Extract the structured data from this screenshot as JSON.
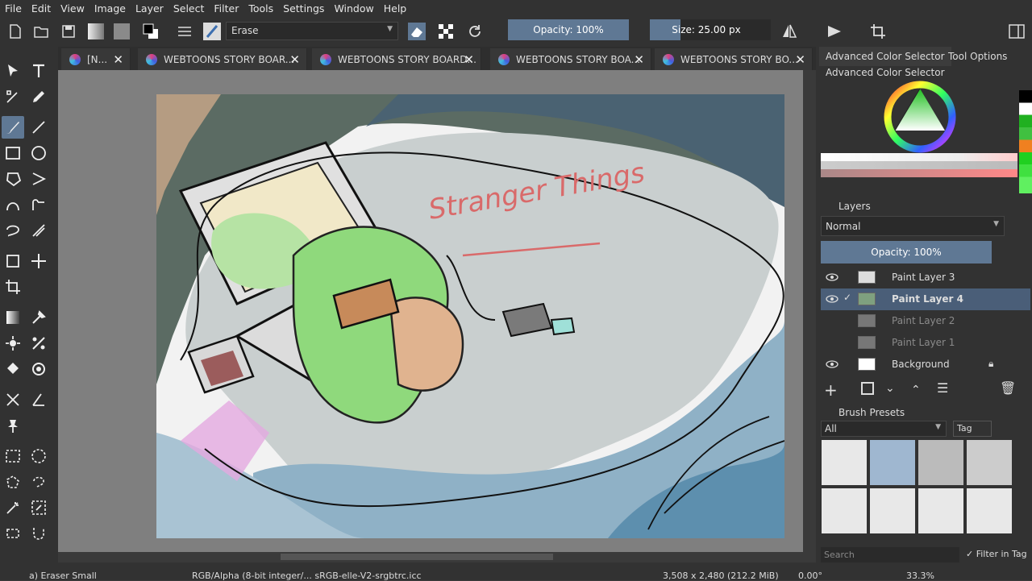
{
  "menu": [
    "File",
    "Edit",
    "View",
    "Image",
    "Layer",
    "Select",
    "Filter",
    "Tools",
    "Settings",
    "Window",
    "Help"
  ],
  "toolbar": {
    "brush_blending_mode": "Erase",
    "opacity_label": "Opacity: 100%",
    "size_label": "Size: 25.00 px",
    "size_fraction": 0.25
  },
  "tabs": [
    {
      "label": "[N..."
    },
    {
      "label": "WEBTOONS STORY BOAR..."
    },
    {
      "label": "WEBTOONS STORY BOARD..."
    },
    {
      "label": "WEBTOONS STORY BOA..."
    },
    {
      "label": "WEBTOONS STORY BO..."
    }
  ],
  "docker": {
    "tab_color_selector": "Advanced Color Selector",
    "tab_tool_options": "Tool Options",
    "color_selector_title": "Advanced Color Selector",
    "layers_title": "Layers",
    "blend_mode": "Normal",
    "layer_opacity": "Opacity:  100%",
    "layers": [
      {
        "name": "Paint Layer 3",
        "visible": true,
        "active": false
      },
      {
        "name": "Paint Layer 4",
        "visible": true,
        "active": true
      },
      {
        "name": "Paint Layer 2",
        "visible": false,
        "active": false
      },
      {
        "name": "Paint Layer 1",
        "visible": false,
        "active": false
      },
      {
        "name": "Background",
        "visible": true,
        "active": false
      }
    ],
    "brush_presets_title": "Brush Presets",
    "preset_filter": "All",
    "tag_label": "Tag",
    "search_placeholder": "Search",
    "filter_in_tag": "Filter in Tag"
  },
  "canvas": {
    "sketch_text": "Stranger Things",
    "palette": {
      "wall": "#5b6b63",
      "bed": "#c9cfcf",
      "blanket": "#8fb1c6",
      "green": "#8fd97c",
      "laptop": "#e0e0e0",
      "skin": "#e0b38f",
      "pink": "#e4a9e0",
      "red_text": "#d96a6a",
      "floor": "#b59c82"
    }
  },
  "status": {
    "brush": "a) Eraser Small",
    "color_space": "RGB/Alpha (8-bit integer/...  sRGB-elle-V2-srgbtrc.icc",
    "image_size": "3,508 x 2,480 (212.2 MiB)",
    "rotation": "0.00°",
    "zoom": "33.3%"
  }
}
